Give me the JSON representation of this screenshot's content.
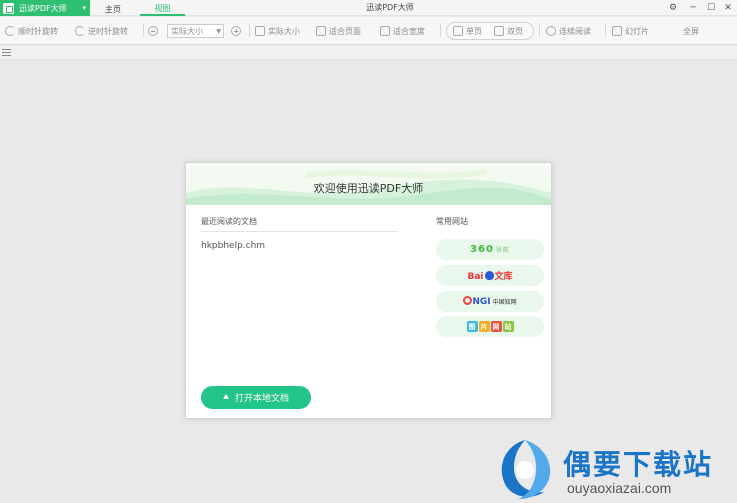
{
  "titlebar": {
    "app_name": "迅读PDF大师",
    "tabs": [
      "主页",
      "视图"
    ],
    "window_title": "迅读PDF大师"
  },
  "toolbar": {
    "rotate_cw": "顺时针旋转",
    "rotate_ccw": "逆时针旋转",
    "zoom_value": "实际大小",
    "actual_size": "实际大小",
    "fit_page": "适合页面",
    "fit_width": "适合宽度",
    "single_page": "单页",
    "double_page": "双页",
    "continuous": "连续阅读",
    "slideshow": "幻灯片",
    "fullscreen": "全屏"
  },
  "dialog": {
    "title": "欢迎使用迅读PDF大师",
    "recent_label": "最近阅读的文档",
    "recent_files": [
      "hkpbhelp.chm"
    ],
    "sites_label": "常用网站",
    "sites": [
      "360导航",
      "Bai文库",
      "CNKI中国知网",
      "图片网站"
    ],
    "open_button": "打开本地文档"
  },
  "watermark": {
    "title": "偶要下载站",
    "url": "ouyaoxiazai.com"
  },
  "colors": {
    "accent": "#2fbf73",
    "button": "#23c48a",
    "watermark": "#1a74c8"
  }
}
